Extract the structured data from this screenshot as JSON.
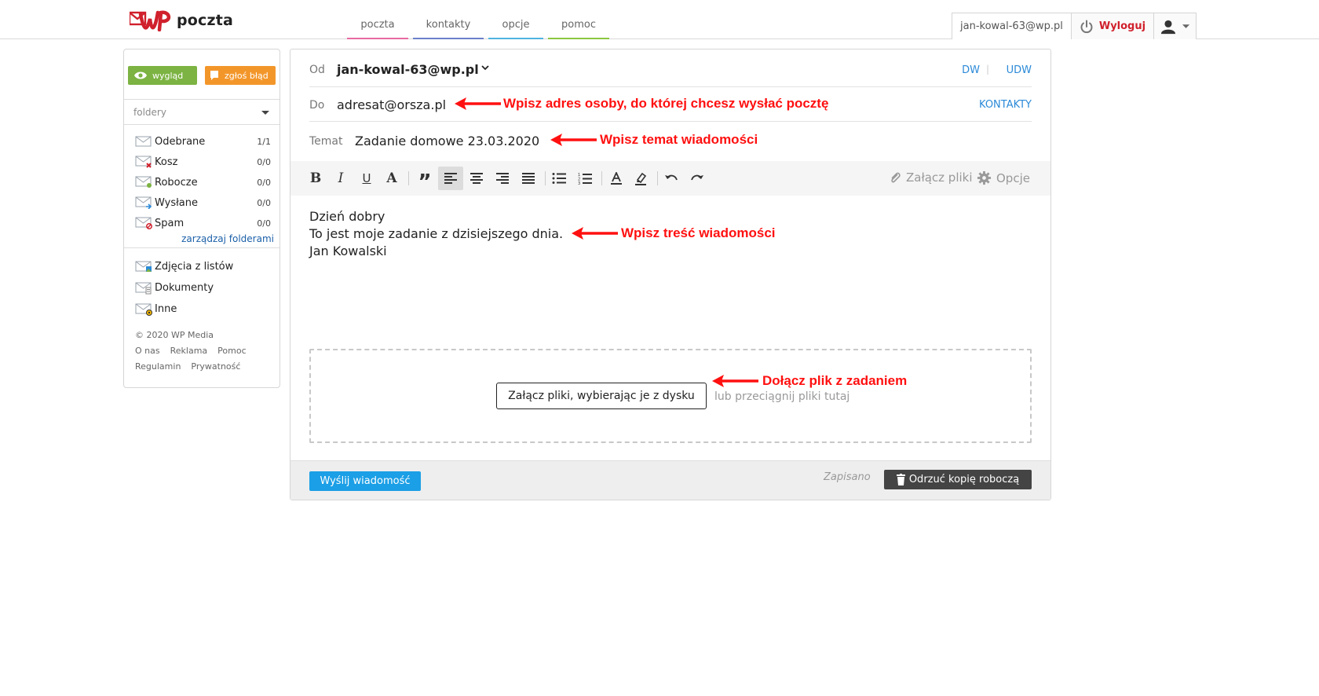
{
  "header": {
    "logo_text": "poczta",
    "nav": [
      {
        "label": "poczta",
        "color": "#e86aa0"
      },
      {
        "label": "kontakty",
        "color": "#6b7fc9"
      },
      {
        "label": "opcje",
        "color": "#4fb3e0"
      },
      {
        "label": "pomoc",
        "color": "#8cc63f"
      }
    ],
    "user_email": "jan-kowal-63@wp.pl",
    "logout_label": "Wyloguj",
    "brand_color": "#d0202c"
  },
  "sidebar": {
    "look_label": "wygląd",
    "bug_label": "zgłoś błąd",
    "folders_label": "foldery",
    "folders": [
      {
        "name": "Odebrane",
        "count": "1/1",
        "icon": "inbox-icon"
      },
      {
        "name": "Kosz",
        "count": "0/0",
        "icon": "trash-folder-icon"
      },
      {
        "name": "Robocze",
        "count": "0/0",
        "icon": "drafts-icon"
      },
      {
        "name": "Wysłane",
        "count": "0/0",
        "icon": "sent-icon"
      },
      {
        "name": "Spam",
        "count": "0/0",
        "icon": "spam-icon"
      }
    ],
    "manage_label": "zarządzaj folderami",
    "smart_folders": [
      {
        "name": "Zdjęcia z listów",
        "icon": "photos-icon"
      },
      {
        "name": "Dokumenty",
        "icon": "documents-icon"
      },
      {
        "name": "Inne",
        "icon": "other-icon"
      }
    ],
    "footer": {
      "copyright": "© 2020 WP Media",
      "links": [
        "O nas",
        "Reklama",
        "Pomoc",
        "Regulamin",
        "Prywatność"
      ]
    }
  },
  "compose": {
    "from_label": "Od",
    "from_value": "jan-kowal-63@wp.pl",
    "cc_label": "DW",
    "bcc_label": "UDW",
    "to_label": "Do",
    "to_value": "adresat@orsza.pl",
    "contacts_label": "KONTAKTY",
    "subject_label": "Temat",
    "subject_value": "Zadanie domowe 23.03.2020",
    "toolbar": {
      "attach_label": "Załącz pliki",
      "options_label": "Opcje"
    },
    "body_lines": [
      "Dzień dobry",
      "To jest moje zadanie z dzisiejszego dnia.",
      "Jan Kowalski"
    ],
    "attach_button_label": "Załącz pliki, wybierając je z dysku",
    "drop_hint": "lub przeciągnij pliki tutaj",
    "send_label": "Wyślij wiadomość",
    "saved_label": "Zapisano",
    "discard_label": "Odrzuć kopię roboczą"
  },
  "annotations": {
    "to": "Wpisz adres osoby, do której chcesz wysłać pocztę",
    "subject": "Wpisz temat wiadomości",
    "body": "Wpisz treść wiadomości",
    "attach": "Dołącz plik z zadaniem",
    "color": "#ff1010"
  }
}
